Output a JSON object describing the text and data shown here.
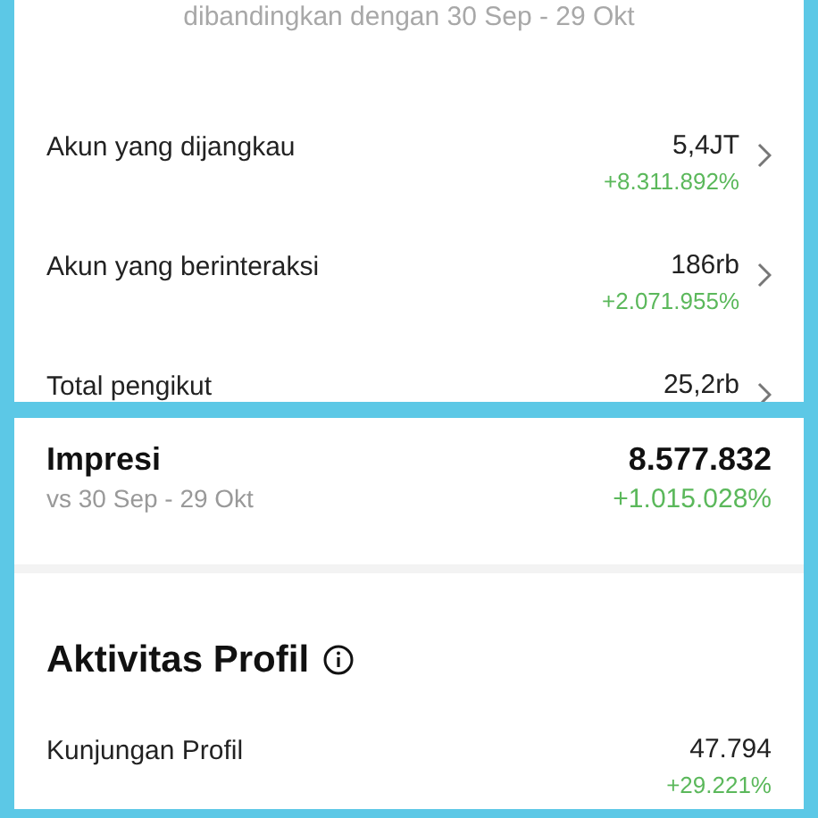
{
  "top_panel": {
    "comparison_note": "dibandingkan dengan 30 Sep - 29 Okt",
    "metrics": [
      {
        "label": "Akun yang dijangkau",
        "value": "5,4JT",
        "change": "+8.311.892%"
      },
      {
        "label": "Akun yang berinteraksi",
        "value": "186rb",
        "change": "+2.071.955%"
      },
      {
        "label": "Total pengikut",
        "value": "25,2rb"
      }
    ]
  },
  "bottom_panel": {
    "impressions": {
      "title": "Impresi",
      "period": "vs 30 Sep - 29 Okt",
      "value": "8.577.832",
      "change": "+1.015.028%"
    },
    "section_title": "Aktivitas Profil",
    "rows": [
      {
        "label": "Kunjungan Profil",
        "value": "47.794",
        "change": "+29.221%"
      }
    ]
  }
}
